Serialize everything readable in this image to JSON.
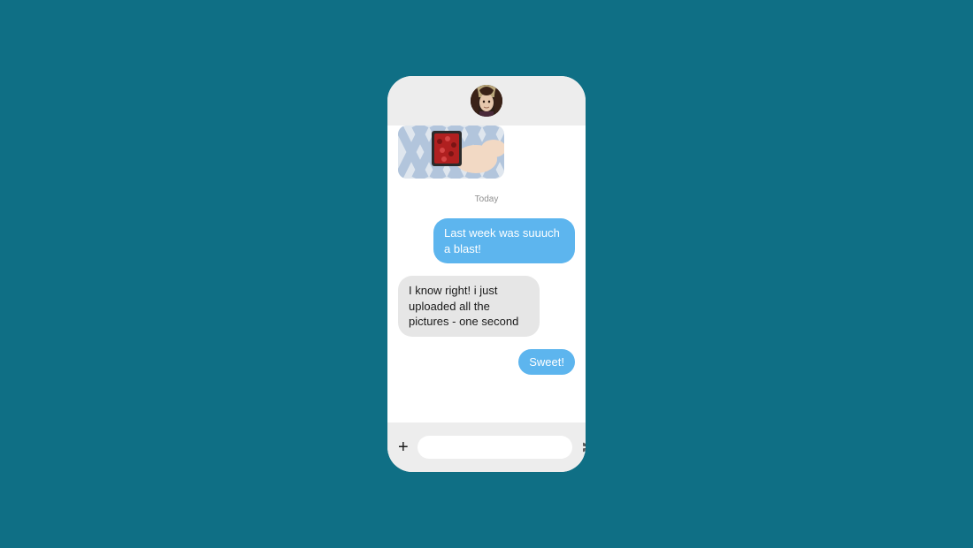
{
  "colors": {
    "page_bg": "#0f6f85",
    "sent_bubble": "#5db5ee",
    "received_bubble": "#e6e6e6",
    "bar_bg": "#ededed"
  },
  "header": {
    "avatar_name": "contact-avatar"
  },
  "thread": {
    "attachment_name": "image-attachment",
    "timestamp": "Today",
    "messages": [
      {
        "side": "sent",
        "text": "Last week was suuuch a blast!"
      },
      {
        "side": "received",
        "text": "I know right! i just uploaded all the pictures - one second"
      },
      {
        "side": "sent",
        "text": "Sweet!"
      }
    ]
  },
  "composer": {
    "add_label": "+",
    "input_placeholder": "",
    "send_label": "send"
  }
}
